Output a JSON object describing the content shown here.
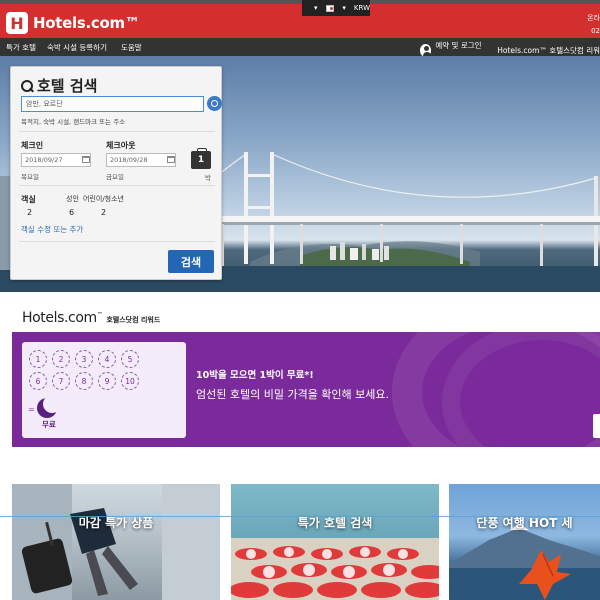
{
  "header": {
    "logo_text": "Hotels.com™",
    "locale_currency": "KRW",
    "right_text_1": "온라",
    "right_text_2": "02"
  },
  "nav": {
    "items": [
      "특가 호텔",
      "숙박 시설 등록하기",
      "도움말"
    ],
    "login_label": "예약 및 로그인 ⌄",
    "rewards_link": "Hotels.com™ 호텔스닷컴 리워"
  },
  "search": {
    "title": "호텔 검색",
    "destination_value": "암만, 요르단",
    "destination_hint": "목적지, 숙박 시설, 랜드마크 또는 주소",
    "checkin_label": "체크인",
    "checkin_value": "2018/09/27",
    "checkin_day": "목요일",
    "checkout_label": "체크아웃",
    "checkout_value": "2018/09/28",
    "checkout_day": "금요일",
    "nights": "1",
    "nights_word": "박",
    "rooms_label": "객실",
    "rooms_value": "2",
    "adults_label": "성인",
    "adults_value": "6",
    "children_label": "어린이/청소년",
    "children_value": "2",
    "edit_rooms_link": "객실 수정 또는 추가",
    "search_button": "검색"
  },
  "rewards": {
    "brand": "Hotels.com",
    "brand_mark": "™",
    "subtitle": "호텔스닷컴 리워드",
    "stamps": [
      "1",
      "2",
      "3",
      "4",
      "5",
      "6",
      "7",
      "8",
      "9",
      "10"
    ],
    "equals": "=",
    "free_label": "무료",
    "headline": "10박을 모으면 1박이 무료*!",
    "subline": "엄선된 호텔의 비밀 가격을 확인해 보세요."
  },
  "deals": [
    {
      "title": "마감 특가 상품"
    },
    {
      "title": "특가 호텔 검색"
    },
    {
      "title": "단풍 여행 HOT 세"
    }
  ],
  "colors": {
    "brand_red": "#d32f2f",
    "nav_dark": "#333333",
    "search_blue": "#2266b4",
    "rewards_purple": "#7b2a9b"
  }
}
